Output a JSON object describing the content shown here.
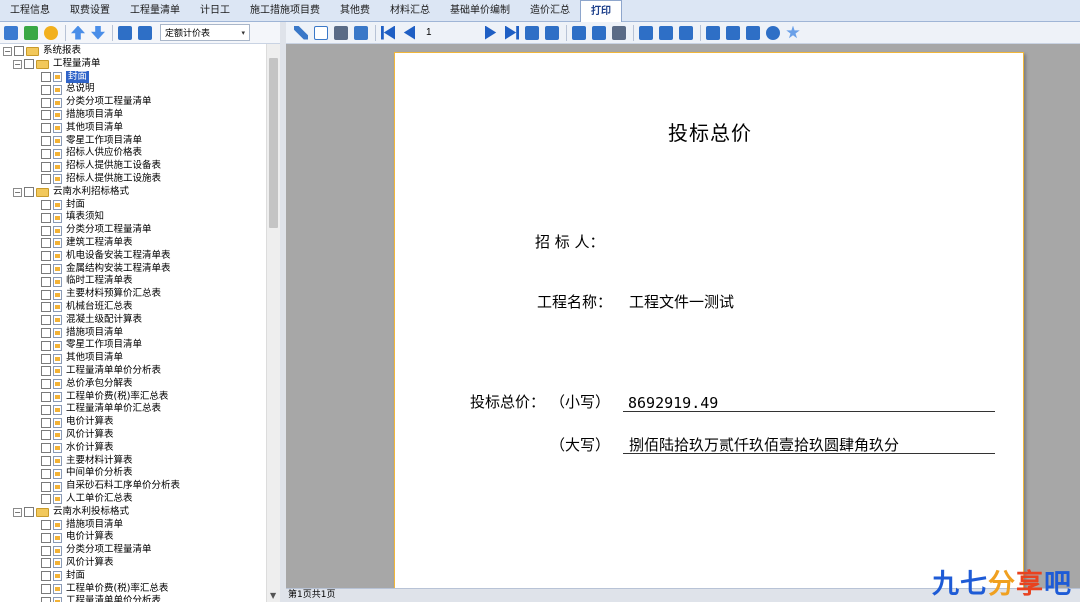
{
  "tabs": [
    {
      "label": "工程信息",
      "active": false
    },
    {
      "label": "取费设置",
      "active": false
    },
    {
      "label": "工程量清单",
      "active": false
    },
    {
      "label": "计日工",
      "active": false
    },
    {
      "label": "施工措施项目费",
      "active": false
    },
    {
      "label": "其他费",
      "active": false
    },
    {
      "label": "材料汇总",
      "active": false
    },
    {
      "label": "基础单价编制",
      "active": false
    },
    {
      "label": "造价汇总",
      "active": false
    },
    {
      "label": "打印",
      "active": true
    }
  ],
  "left_toolbar": {
    "icons": [
      "report-manager-icon",
      "add-report-icon",
      "delete-icon",
      "move-up-icon",
      "move-down-icon",
      "export-icon",
      "import-icon"
    ],
    "combo_value": "定额计价表"
  },
  "tree": {
    "root": {
      "label": "系统报表"
    },
    "groups": [
      {
        "label": "工程量清单",
        "items": [
          "封面",
          "总说明",
          "分类分项工程量清单",
          "措施项目清单",
          "其他项目清单",
          "零星工作项目清单",
          "招标人供应价格表",
          "招标人提供施工设备表",
          "招标人提供施工设施表"
        ]
      },
      {
        "label": "云南水利招标格式",
        "items": [
          "封面",
          "填表须知",
          "分类分项工程量清单",
          "建筑工程清单表",
          "机电设备安装工程清单表",
          "金属结构安装工程清单表",
          "临时工程清单表",
          "主要材料预算价汇总表",
          "机械台班汇总表",
          "混凝土级配计算表",
          "措施项目清单",
          "零星工作项目清单",
          "其他项目清单",
          "工程量清单单价分析表",
          "总价承包分解表",
          "工程单价费(税)率汇总表",
          "工程量清单单价汇总表",
          "电价计算表",
          "风价计算表",
          "水价计算表",
          "主要材料计算表",
          "中间单价分析表",
          "自采砂石料工序单价分析表",
          "人工单价汇总表"
        ]
      },
      {
        "label": "云南水利投标格式",
        "items": [
          "措施项目清单",
          "电价计算表",
          "分类分项工程量清单",
          "风价计算表",
          "封面",
          "工程单价费(税)率汇总表",
          "工程量清单单价分析表"
        ]
      }
    ],
    "selected": "封面"
  },
  "print_toolbar": {
    "page_number": "1"
  },
  "document": {
    "title": "投标总价",
    "tenderee_label": "招 标 人：",
    "project_name_label": "工程名称：",
    "project_name_value": "工程文件一测试",
    "total_label": "投标总价：",
    "lower_label": "（小写）",
    "lower_value": "8692919.49",
    "upper_label": "（大写）",
    "upper_value": "捌佰陆拾玖万贰仟玖佰壹拾玖圆肆角玖分"
  },
  "status": {
    "page_info": "第1页共1页"
  },
  "watermark": {
    "text": "九七分享吧",
    "colors": [
      "#1e5bd6",
      "#1e5bd6",
      "#f0a020",
      "#e8421f",
      "#1e5bd6"
    ]
  },
  "colors": {
    "tab_active_text": "#1d3f8a",
    "selection": "#2f64c9",
    "page_border": "#f0b63a"
  }
}
